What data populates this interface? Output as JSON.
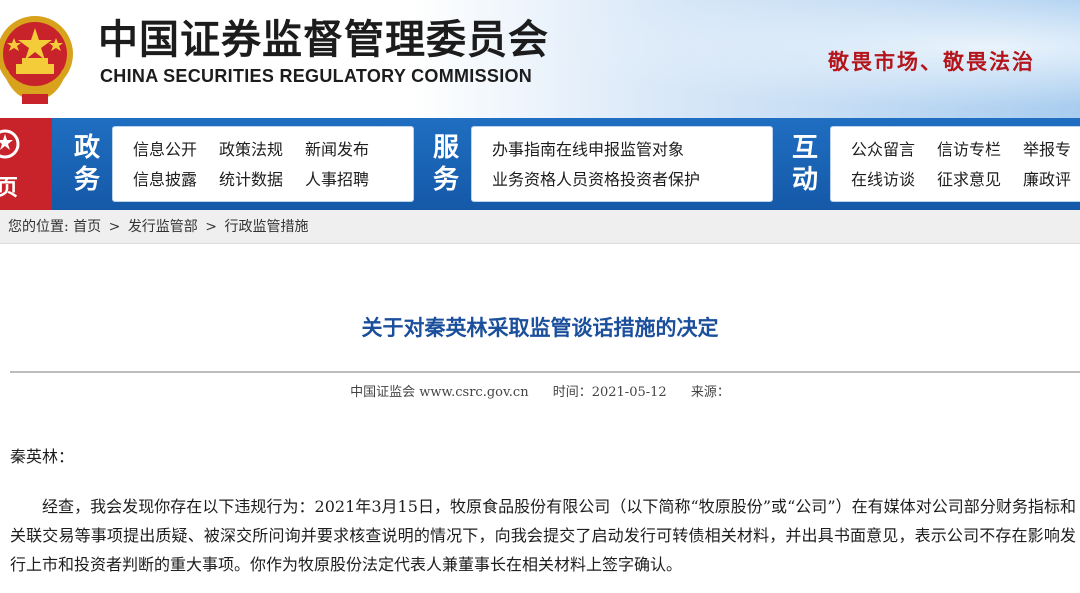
{
  "header": {
    "title_cn": "中国证券监督管理委员会",
    "title_en": "CHINA SECURITIES REGULATORY COMMISSION",
    "slogan": "敬畏市场、敬畏法治"
  },
  "nav": {
    "home_label": "页",
    "sections": [
      {
        "label_line1": "政",
        "label_line2": "务",
        "row1": [
          "信息公开",
          "政策法规",
          "新闻发布"
        ],
        "row2": [
          "信息披露",
          "统计数据",
          "人事招聘"
        ]
      },
      {
        "label_line1": "服",
        "label_line2": "务",
        "row1": [
          "办事指南",
          "在线申报",
          "监管对象"
        ],
        "row2": [
          "业务资格",
          "人员资格",
          "投资者保护"
        ]
      },
      {
        "label_line1": "互",
        "label_line2": "动",
        "row1": [
          "公众留言",
          "信访专栏",
          "举报专"
        ],
        "row2": [
          "在线访谈",
          "征求意见",
          "廉政评"
        ]
      }
    ]
  },
  "breadcrumb": {
    "prefix": "您的位置:",
    "items": [
      "首页",
      "发行监管部",
      "行政监管措施"
    ],
    "separator": ">"
  },
  "article": {
    "title": "关于对秦英林采取监管谈话措施的决定",
    "source_label": "中国证监会 www.csrc.gov.cn",
    "time_label": "时间：2021-05-12",
    "origin_label": "来源：",
    "salutation": "秦英林：",
    "paragraph1": "经查，我会发现你存在以下违规行为：2021年3月15日，牧原食品股份有限公司（以下简称“牧原股份”或“公司”）在有媒体对公司部分财务指标和关联交易等事项提出质疑、被深交所问询并要求核查说明的情况下，向我会提交了启动发行可转债相关材料，并出具书面意见，表示公司不存在影响发行上市和投资者判断的重大事项。你作为牧原股份法定代表人兼董事长在相关材料上签字确认。"
  },
  "colors": {
    "nav_blue": "#1f6ec1",
    "title_blue": "#1b4f9c",
    "slogan_red": "#b3151b",
    "home_red": "#c8232b"
  }
}
